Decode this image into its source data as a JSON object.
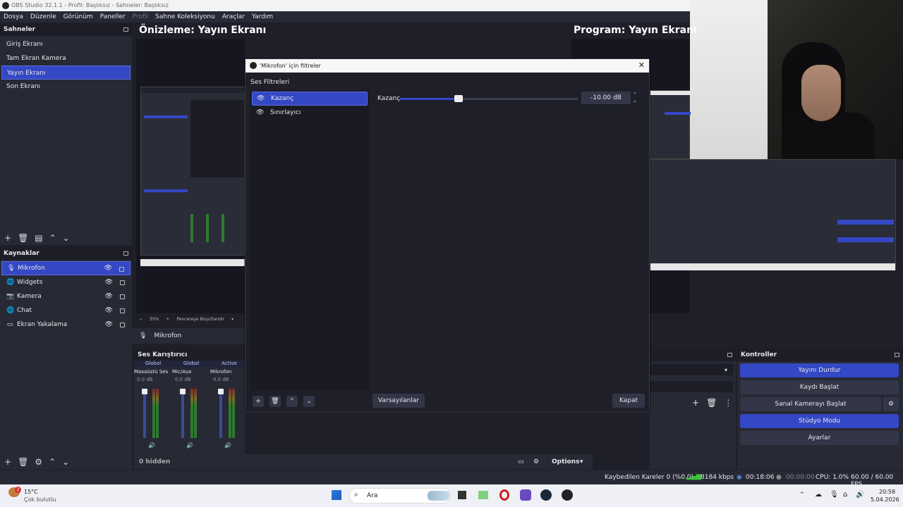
{
  "window": {
    "title": "OBS Studio 32.1.1 - Profil: Başlıksız - Sahneler: Başlıksız"
  },
  "menu": {
    "items": [
      "Dosya",
      "Düzenle",
      "Görünüm",
      "Paneller",
      "Profil",
      "Sahne Koleksiyonu",
      "Araçlar",
      "Yardım"
    ]
  },
  "scenes": {
    "title": "Sahneler",
    "items": [
      "Giriş Ekranı",
      "Tam Ekran Kamera",
      "Yayın Ekranı",
      "Son Ekranı"
    ],
    "selected": 2
  },
  "sources": {
    "title": "Kaynaklar",
    "items": [
      {
        "label": "Mikrofon",
        "icon": "microphone-icon"
      },
      {
        "label": "Widgets",
        "icon": "globe-icon"
      },
      {
        "label": "Kamera",
        "icon": "camera-icon"
      },
      {
        "label": "Chat",
        "icon": "globe-icon"
      },
      {
        "label": "Ekran Yakalama",
        "icon": "monitor-icon"
      }
    ]
  },
  "preview": {
    "title": "Önizleme: Yayın Ekranı",
    "zoom": "35%",
    "fit_label": "Pencereye Boyutlandır"
  },
  "program": {
    "title": "Program: Yayın Ekranı"
  },
  "source_bar": {
    "label": "Mikrofon"
  },
  "mixer": {
    "title": "Ses Karıştırıcı",
    "channels": [
      {
        "scope": "Global",
        "name": "Masaüstü Ses",
        "db": "0.0 dB"
      },
      {
        "scope": "Global",
        "name": "Mic/Aux",
        "db": "0.0 dB"
      },
      {
        "scope": "Active",
        "name": "Mikrofon",
        "db": "0.0 dB"
      }
    ],
    "ticks": [
      "0",
      "-6",
      "-12",
      "-18",
      "-24",
      "-30",
      "-36",
      "-42",
      "-48",
      "-54",
      "-60"
    ]
  },
  "bottom_bar": {
    "hidden": "0 hidden",
    "options": "Options"
  },
  "controls": {
    "title": "Kontroller",
    "buttons": [
      "Yayını Durdur",
      "Kaydı Başlat",
      "Sanal Kamerayı Başlat",
      "Stüdyo Modu",
      "Ayarlar"
    ]
  },
  "dialog": {
    "title": "'Mikrofon' için filtreler",
    "section": "Ses Filtreleri",
    "filters": [
      "Kazanç",
      "Sınırlayıcı"
    ],
    "gain_label": "Kazanç",
    "gain_value": "-10.00 dB",
    "gain_level": 0.33,
    "defaults_btn": "Varsayılanlar",
    "close_btn": "Kapat"
  },
  "status": {
    "dropped": "Kaybedilen Kareler 0 (%0.0)",
    "bitrate": "8184 kbps",
    "stream_time": "00:18:06",
    "rec_time": "00:00:00",
    "cpu": "CPU: 1.0%",
    "fps": "60.00 / 60.00 FPS"
  },
  "taskbar": {
    "temp": "15°C",
    "weather": "Çok bulutlu",
    "search": "Ara",
    "time": "20:58",
    "date": "5.04.2026",
    "badge": "2"
  },
  "colors": {
    "accent": "#3448c5",
    "panel": "#272935",
    "bg": "#1e1f29"
  }
}
